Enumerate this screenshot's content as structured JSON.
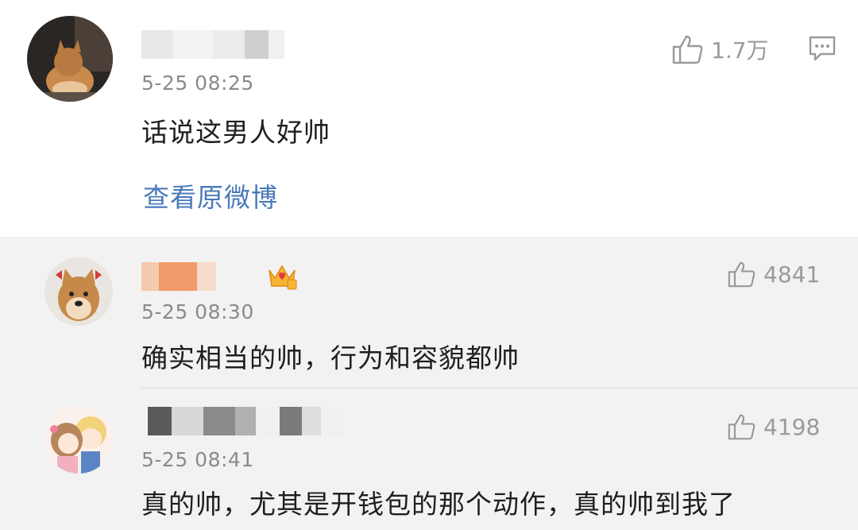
{
  "main_comment": {
    "time": "5-25 08:25",
    "text": "话说这男人好帅",
    "likes": "1.7万",
    "view_original": "查看原微博"
  },
  "replies": [
    {
      "time": "5-25 08:30",
      "text": "确实相当的帅，行为和容貌都帅",
      "likes": "4841"
    },
    {
      "time": "5-25 08:41",
      "text": "真的帅，尤其是开钱包的那个动作，真的帅到我了",
      "likes": "4198"
    }
  ],
  "colors": {
    "link": "#4a7bb8",
    "reply_bg": "#f2f2f2",
    "meta": "#8a8a8a",
    "badge": "#f0a020"
  },
  "icons": [
    "thumbs-up-icon",
    "comment-reply-icon",
    "crown-badge-icon"
  ]
}
